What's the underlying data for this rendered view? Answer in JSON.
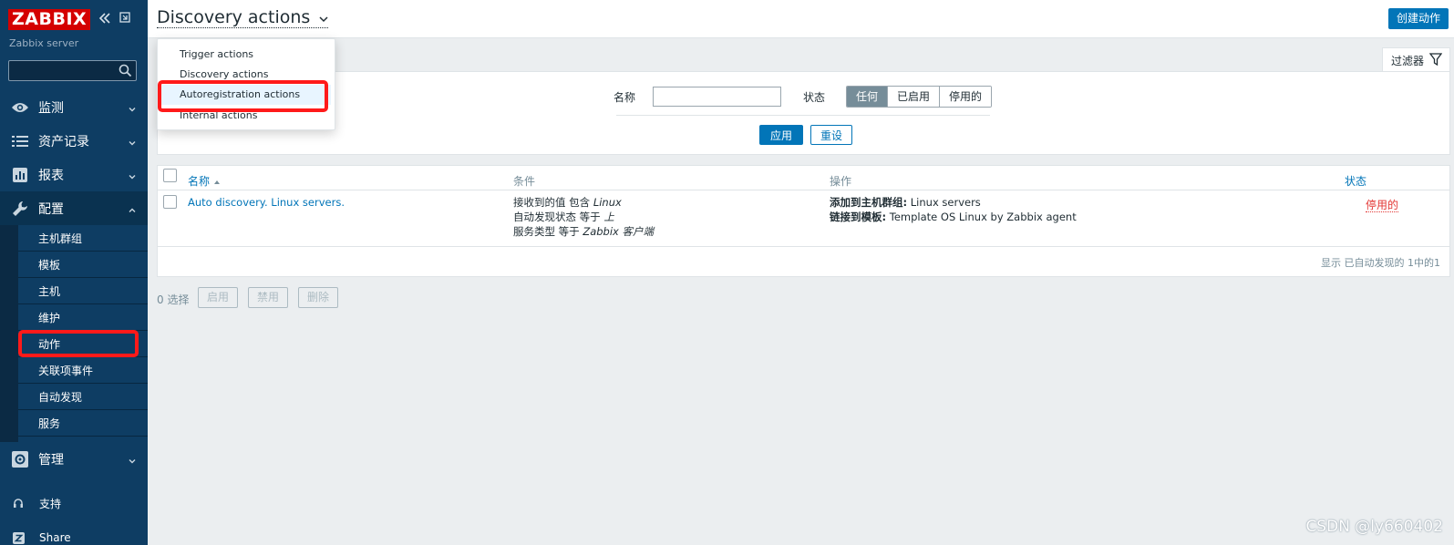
{
  "app": {
    "logo": "ZABBIX",
    "server_name": "Zabbix server"
  },
  "sidebar": {
    "menu": [
      {
        "label": "监测",
        "icon": "eye-icon"
      },
      {
        "label": "资产记录",
        "icon": "list-icon"
      },
      {
        "label": "报表",
        "icon": "report-icon"
      },
      {
        "label": "配置",
        "icon": "wrench-icon"
      },
      {
        "label": "管理",
        "icon": "gear-icon"
      }
    ],
    "config_items": [
      "主机群组",
      "模板",
      "主机",
      "维护",
      "动作",
      "关联项事件",
      "自动发现",
      "服务"
    ],
    "utility": [
      {
        "label": "支持",
        "icon": "headset-icon"
      },
      {
        "label": "Share",
        "icon": "share-z-icon"
      }
    ]
  },
  "header": {
    "title": "Discovery actions",
    "create_button": "创建动作"
  },
  "action_type_menu": {
    "items": [
      "Trigger actions",
      "Discovery actions",
      "Autoregistration actions",
      "Internal actions"
    ]
  },
  "filter": {
    "tab_label": "过滤器",
    "name_label": "名称",
    "name_value": "",
    "status_label": "状态",
    "status_options": [
      "任何",
      "已启用",
      "停用的"
    ],
    "status_selected": "任何",
    "apply": "应用",
    "reset": "重设"
  },
  "table": {
    "columns": [
      "名称",
      "条件",
      "操作",
      "状态"
    ],
    "rows": [
      {
        "name": "Auto discovery. Linux servers.",
        "conditions": [
          {
            "text": "接收到的值 包含 ",
            "value": "Linux"
          },
          {
            "text": "自动发现状态 等于 ",
            "value": "上"
          },
          {
            "text": "服务类型 等于 ",
            "value": "Zabbix 客户端"
          }
        ],
        "operations": [
          {
            "label": "添加到主机群组:",
            "value": " Linux servers"
          },
          {
            "label": "链接到模板:",
            "value": " Template OS Linux by Zabbix agent"
          }
        ],
        "status": "停用的"
      }
    ],
    "footer": "显示 已自动发现的 1中的1"
  },
  "mass_actions": {
    "selected": "0 选择",
    "buttons": [
      "启用",
      "禁用",
      "删除"
    ]
  },
  "watermark": "CSDN @ly660402",
  "colors": {
    "sidebar": "#0e3d63",
    "accent": "#0275b8",
    "logo": "#d40000",
    "highlight_box": "#ff1a1a",
    "disabled_status": "#e33734"
  }
}
